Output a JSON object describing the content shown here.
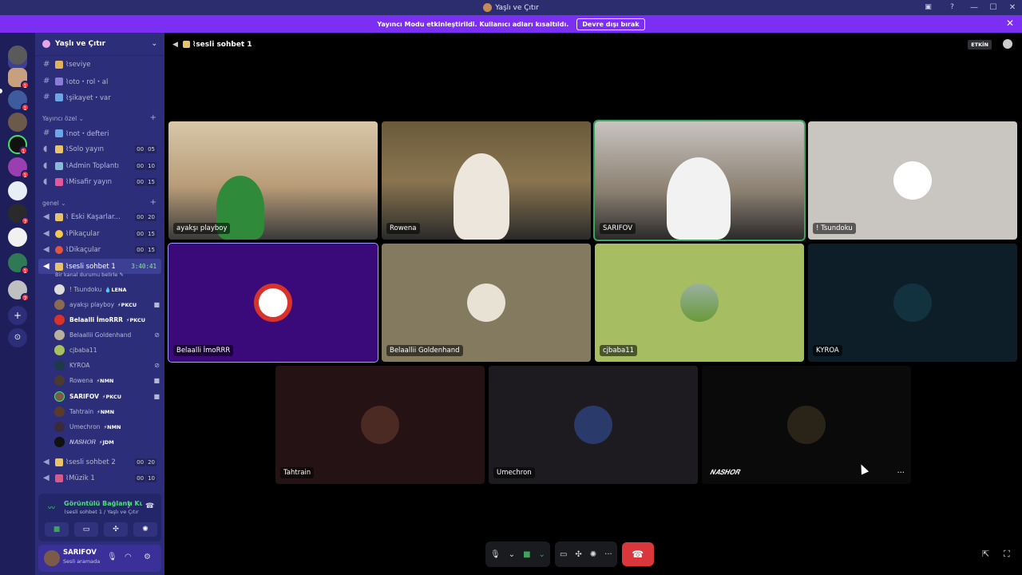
{
  "window": {
    "title": "Yaşlı ve Çıtır",
    "controls": [
      "—",
      "☐",
      "✕"
    ]
  },
  "banner": {
    "text": "Yayıncı Modu etkinleştirildi. Kullanıcı adları kısaltıldı.",
    "button_label": "Devre dışı bırak"
  },
  "rail": {
    "badges": [
      "1",
      "1",
      "1",
      "1",
      "7",
      "1",
      "7"
    ]
  },
  "guild": {
    "name": "Yaşlı ve Çıtır"
  },
  "channels": {
    "text": [
      {
        "label": "⌇seviye"
      },
      {
        "label": "⌇oto・rol・al"
      },
      {
        "label": "⌇şikayet・var"
      }
    ],
    "cat_yayinci": "Yayıncı özel",
    "yayinci": [
      {
        "label": "⌇not・defteri"
      },
      {
        "label": "⌇Solo yayın",
        "c1": "00",
        "c2": "05"
      },
      {
        "label": "⌇Admin Toplantı",
        "c1": "00",
        "c2": "10"
      },
      {
        "label": "⌇Misafir yayın",
        "c1": "00",
        "c2": "15"
      }
    ],
    "cat_genel": "genel",
    "genel": [
      {
        "label": "⌇ Eski Kaşarlar...",
        "c1": "00",
        "c2": "20"
      },
      {
        "label": "⌇Pikaçular",
        "c1": "00",
        "c2": "15"
      },
      {
        "label": "⌇Dikaçular",
        "c1": "00",
        "c2": "15"
      }
    ],
    "active": {
      "label": "⌇sesli sohbet 1",
      "timer": "3:40:41",
      "status": "Bir kanal durumu belirle ✎"
    },
    "after": [
      {
        "label": "⌇sesli sohbet 2",
        "c1": "00",
        "c2": "20"
      },
      {
        "label": "⌇Müzik 1",
        "c1": "00",
        "c2": "10"
      }
    ]
  },
  "voice_users": [
    {
      "name": "! Tsundoku",
      "tag": "💧LENA"
    },
    {
      "name": "ayakşı playboy",
      "tag": "⚡PKCU"
    },
    {
      "name": "Belaalli İmoRRR",
      "tag": "⚡PKCU"
    },
    {
      "name": "Belaallii Goldenhand",
      "tag": ""
    },
    {
      "name": "cjbaba11",
      "tag": ""
    },
    {
      "name": "KYROA",
      "tag": ""
    },
    {
      "name": "Rowena",
      "tag": "⚡NMN"
    },
    {
      "name": "SARIFOV",
      "tag": "⚡PKCU"
    },
    {
      "name": "Tahtrain",
      "tag": "⚡NMN"
    },
    {
      "name": "Umechron",
      "tag": "⚡NMN"
    },
    {
      "name": "𝑵𝑨𝑺𝑯𝑶𝑹",
      "tag": "⚡JDM"
    }
  ],
  "voice_panel": {
    "status": "Görüntülü Bağlantı Kuruldu",
    "location": "⌇sesli sohbet 1 / Yaşlı ve Çıtır"
  },
  "user_panel": {
    "name": "SARIFOV",
    "status": "Sesli aramada"
  },
  "stage": {
    "channel": "⌇sesli sohbet 1",
    "live_badge": "ETKİN",
    "tiles": [
      {
        "label": "ayakşı playboy"
      },
      {
        "label": "Rowena"
      },
      {
        "label": "SARIFOV"
      },
      {
        "label": "! Tsundoku"
      },
      {
        "label": "Belaalli İmoRRR"
      },
      {
        "label": "Belaallii Goldenhand"
      },
      {
        "label": "cjbaba11"
      },
      {
        "label": "KYROA"
      },
      {
        "label": "Tahtrain"
      },
      {
        "label": "Umechron"
      },
      {
        "label": "𝑵𝑨𝑺𝑯𝑶𝑹",
        "more": "···"
      }
    ]
  },
  "colors": {
    "accent": "#7b2ff2",
    "sidebar": "#2c2e7a",
    "rail": "#1e1f5a",
    "connected": "#4be07d",
    "hangup": "#da373c"
  }
}
